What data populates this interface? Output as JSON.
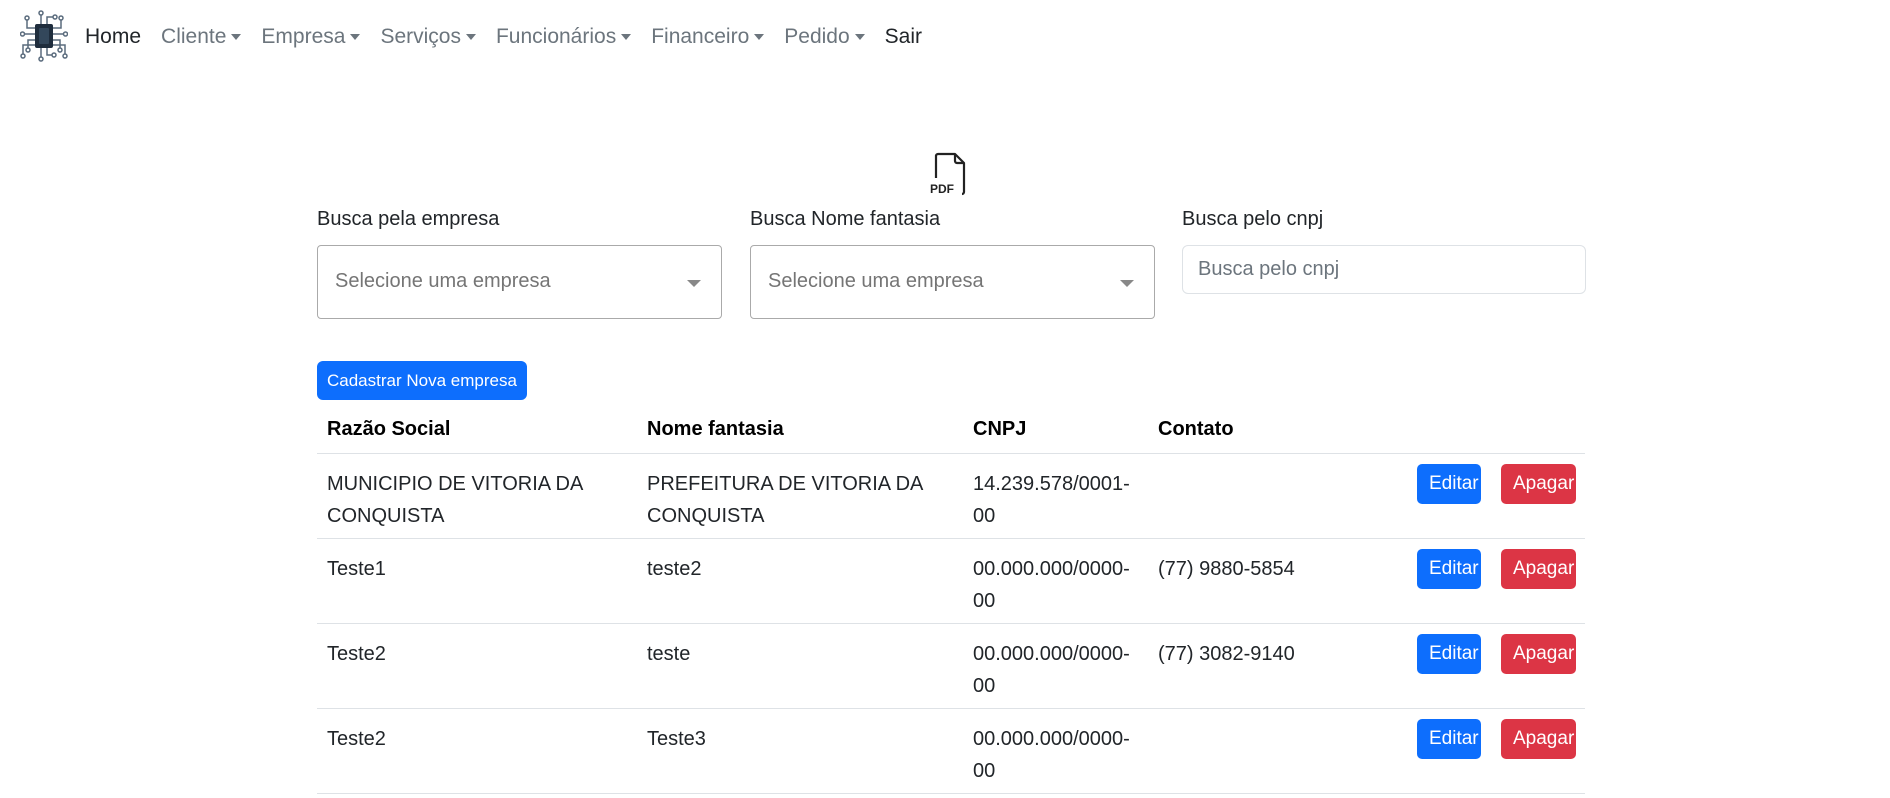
{
  "nav": {
    "items": [
      {
        "label": "Home",
        "dropdown": false,
        "active": true
      },
      {
        "label": "Cliente",
        "dropdown": true,
        "active": false
      },
      {
        "label": "Empresa",
        "dropdown": true,
        "active": false
      },
      {
        "label": "Serviços",
        "dropdown": true,
        "active": false
      },
      {
        "label": "Funcionários",
        "dropdown": true,
        "active": false
      },
      {
        "label": "Financeiro",
        "dropdown": true,
        "active": false
      },
      {
        "label": "Pedido",
        "dropdown": true,
        "active": false
      },
      {
        "label": "Sair",
        "dropdown": false,
        "active": true
      }
    ]
  },
  "pdf": {
    "icon": "pdf-file-icon",
    "label": "PDF"
  },
  "filters": {
    "empresa_label": "Busca pela empresa",
    "empresa_placeholder": "Selecione uma empresa",
    "fantasia_label": "Busca Nome fantasia",
    "fantasia_placeholder": "Selecione uma empresa",
    "cnpj_label": "Busca pelo cnpj",
    "cnpj_placeholder": "Busca pelo cnpj"
  },
  "actions": {
    "new_label": "Cadastrar Nova empresa"
  },
  "table": {
    "headers": [
      "Razão Social",
      "Nome fantasia",
      "CNPJ",
      "Contato"
    ],
    "rows": [
      {
        "razao": "MUNICIPIO DE VITORIA DA CONQUISTA",
        "fantasia": "PREFEITURA DE VITORIA DA CONQUISTA",
        "cnpj": "14.239.578/0001-00",
        "contato": ""
      },
      {
        "razao": "Teste1",
        "fantasia": "teste2",
        "cnpj": "00.000.000/0000-00",
        "contato": "(77) 9880-5854"
      },
      {
        "razao": "Teste2",
        "fantasia": "teste",
        "cnpj": "00.000.000/0000-00",
        "contato": "(77) 3082-9140"
      },
      {
        "razao": "Teste2",
        "fantasia": "Teste3",
        "cnpj": "00.000.000/0000-00",
        "contato": ""
      }
    ],
    "edit_label": "Editar",
    "delete_label": "Apagar"
  },
  "colors": {
    "primary": "#0d6efd",
    "danger": "#dc3545",
    "muted": "#6c757d"
  }
}
